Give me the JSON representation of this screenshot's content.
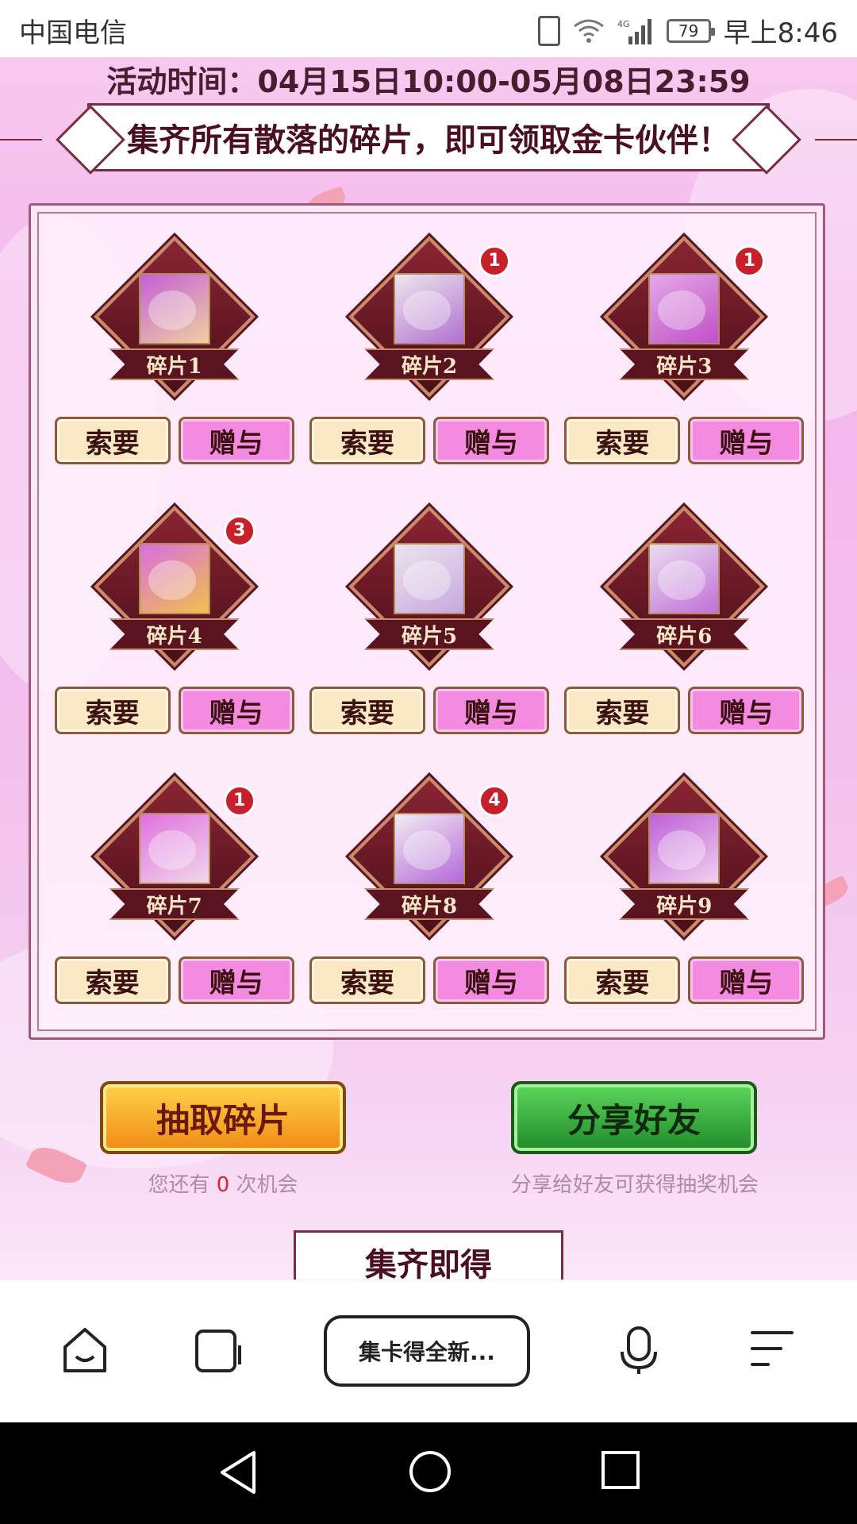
{
  "status_bar": {
    "carrier": "中国电信",
    "network": "4G",
    "battery": "79",
    "time": "早上8:46"
  },
  "activity": {
    "time_label": "活动时间：04月15日10:00-05月08日23:59",
    "banner_text": "集齐所有散落的碎片，即可领取金卡伙伴！"
  },
  "fragments": [
    {
      "label": "碎片1",
      "badge": ""
    },
    {
      "label": "碎片2",
      "badge": "1"
    },
    {
      "label": "碎片3",
      "badge": "1"
    },
    {
      "label": "碎片4",
      "badge": "3"
    },
    {
      "label": "碎片5",
      "badge": ""
    },
    {
      "label": "碎片6",
      "badge": ""
    },
    {
      "label": "碎片7",
      "badge": "1"
    },
    {
      "label": "碎片8",
      "badge": "4"
    },
    {
      "label": "碎片9",
      "badge": ""
    }
  ],
  "fragment_buttons": {
    "ask": "索要",
    "give": "赠与"
  },
  "actions": {
    "draw_label": "抽取碎片",
    "draw_hint_prefix": "您还有",
    "draw_count": "0",
    "draw_hint_suffix": "次机会",
    "share_label": "分享好友",
    "share_hint": "分享给好友可获得抽奖机会"
  },
  "bottom_section": {
    "title": "集齐即得"
  },
  "browser": {
    "url_label": "集卡得全新..."
  },
  "colors": {
    "page_bg": "#f4b6eb",
    "ask_button": "#fbe9c6",
    "give_button": "#f48be0",
    "badge": "#c8202a",
    "draw_button": "#f5a623",
    "share_button": "#2faa35"
  },
  "icons": {
    "home": "home-icon",
    "tabs": "tabs-icon",
    "mic": "mic-icon",
    "menu": "menu-icon",
    "back": "back-triangle-icon",
    "sys_home": "circle-home-icon",
    "recent": "square-recent-icon"
  }
}
